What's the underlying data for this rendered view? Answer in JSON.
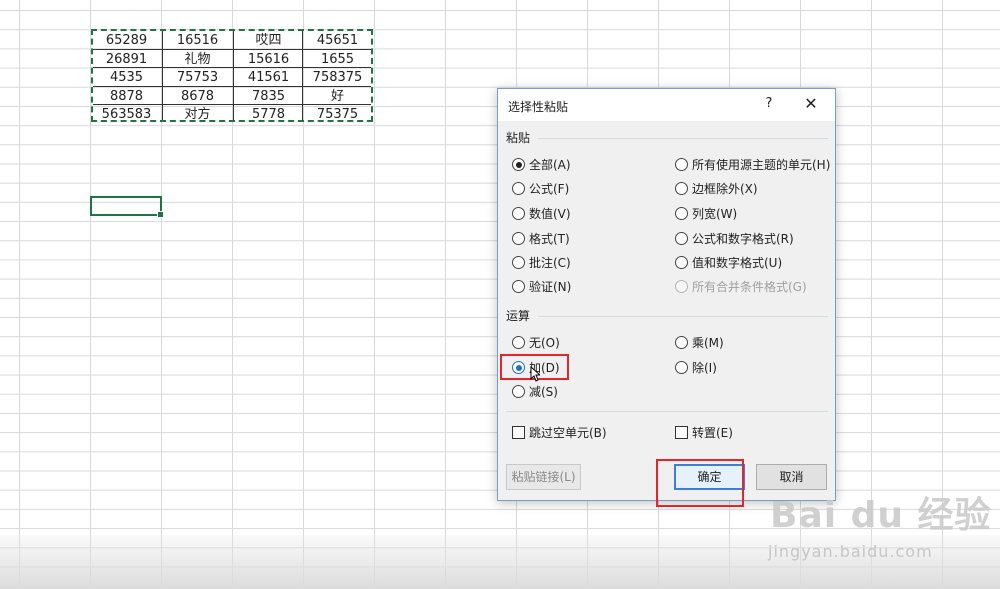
{
  "sheet": {
    "rows": [
      [
        "65289",
        "16516",
        "哎四",
        "45651"
      ],
      [
        "26891",
        "礼物",
        "15616",
        "1655"
      ],
      [
        "4535",
        "75753",
        "41561",
        "758375"
      ],
      [
        "8878",
        "8678",
        "7835",
        "好"
      ],
      [
        "563583",
        "对方",
        "5778",
        "75375"
      ]
    ],
    "accent_color": "#217346"
  },
  "dialog": {
    "title": "选择性粘贴",
    "help": "?",
    "close": "✕",
    "paste_section": "粘贴",
    "paste_options_left": [
      {
        "label": "全部(A)",
        "checked": true
      },
      {
        "label": "公式(F)",
        "checked": false
      },
      {
        "label": "数值(V)",
        "checked": false
      },
      {
        "label": "格式(T)",
        "checked": false
      },
      {
        "label": "批注(C)",
        "checked": false
      },
      {
        "label": "验证(N)",
        "checked": false
      }
    ],
    "paste_options_right": [
      {
        "label": "所有使用源主题的单元(H)",
        "disabled": false
      },
      {
        "label": "边框除外(X)",
        "disabled": false
      },
      {
        "label": "列宽(W)",
        "disabled": false
      },
      {
        "label": "公式和数字格式(R)",
        "disabled": false
      },
      {
        "label": "值和数字格式(U)",
        "disabled": false
      },
      {
        "label": "所有合并条件格式(G)",
        "disabled": true
      }
    ],
    "operation_section": "运算",
    "operation_left": [
      {
        "label": "无(O)",
        "checked": false
      },
      {
        "label": "加(D)",
        "checked": true
      },
      {
        "label": "减(S)",
        "checked": false
      }
    ],
    "operation_right": [
      {
        "label": "乘(M)",
        "checked": false
      },
      {
        "label": "除(I)",
        "checked": false
      }
    ],
    "skip_blanks": "跳过空单元(B)",
    "transpose": "转置(E)",
    "paste_link_button": "粘贴链接(L)",
    "ok_button": "确定",
    "cancel_button": "取消",
    "highlight_color": "#e4252c"
  },
  "watermark": {
    "logo": "Bai du 经验",
    "url": "jingyan.baidu.com"
  }
}
